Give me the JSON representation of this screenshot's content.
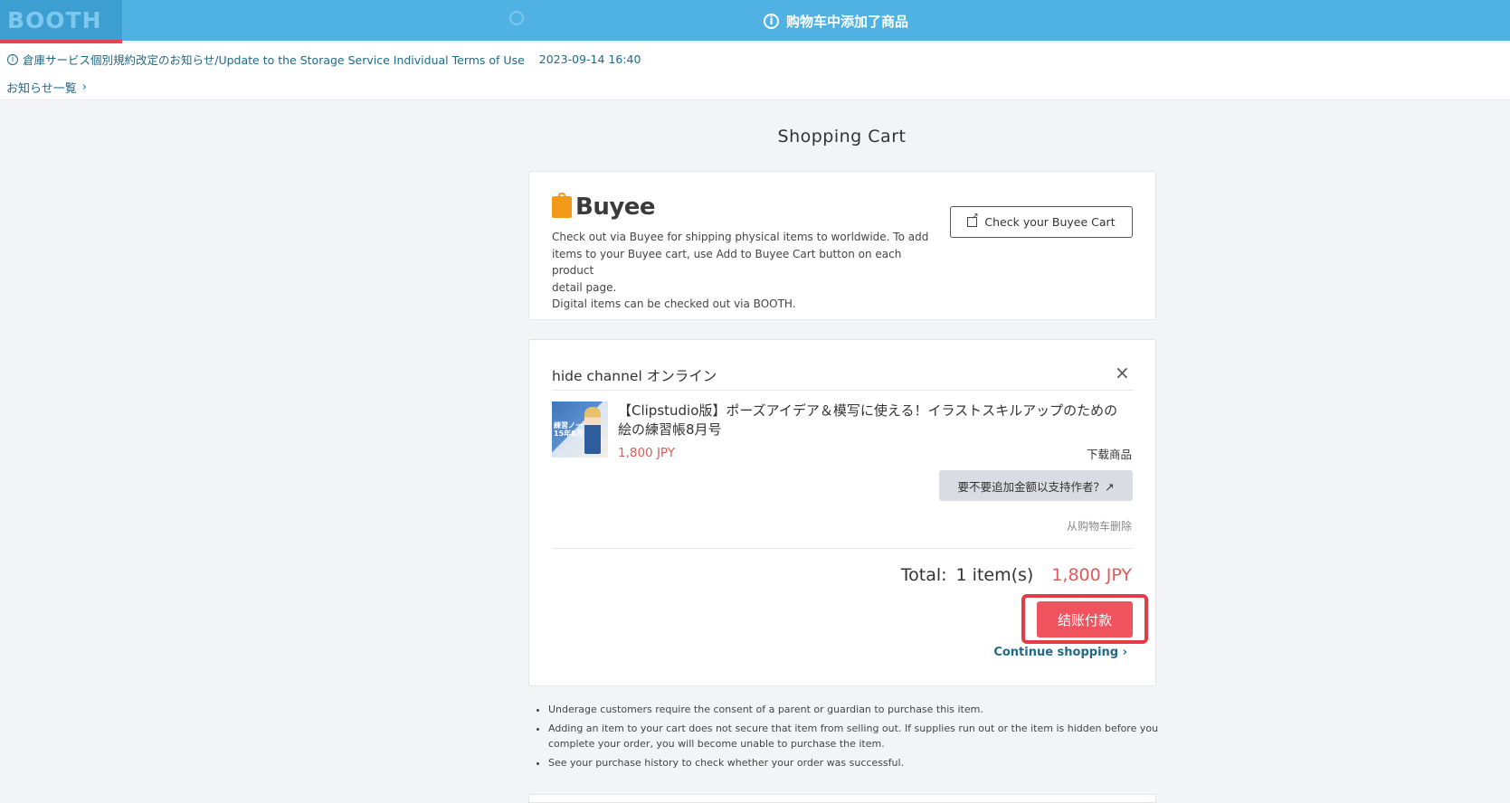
{
  "header": {
    "logo": "BOOTH",
    "toast_message": "购物车中添加了商品",
    "toast_icon": "info-icon",
    "brand_color": "#4fb2e3",
    "accent_color": "#e8414f"
  },
  "notice": {
    "title": "倉庫サービス個別規約改定のお知らせ/Update to the Storage Service Individual Terms of Use",
    "date": "2023-09-14 16:40",
    "list_link": "お知らせ一覧"
  },
  "page_title": "Shopping Cart",
  "buyee": {
    "brand": "Buyee",
    "description_lines": [
      "Check out via Buyee for shipping physical items to worldwide. To add",
      "items to your Buyee cart, use Add to Buyee Cart button on each product",
      "detail page.",
      "Digital items can be checked out via BOOTH."
    ],
    "button_label": "Check your Buyee Cart"
  },
  "cart": {
    "shop_name": "hide channel オンライン",
    "item": {
      "title": "【Clipstudio版】ポーズアイデア＆模写に使える！イラストスキルアップのための絵の練習帳8月号",
      "price": "1,800 JPY",
      "type": "下载商品",
      "thumb_text": "練習ノート\n15年8月号"
    },
    "support_button": "要不要追加金额以支持作者？↗",
    "remove_link": "从购物车删除",
    "total_label": "Total:",
    "total_count": "1 item(s)",
    "total_price": "1,800 JPY",
    "checkout_button": "结账付款",
    "continue_link": "Continue shopping ›",
    "price_color": "#e05a5a"
  },
  "notes": [
    "Underage customers require the consent of a parent or guardian to purchase this item.",
    "Adding an item to your cart does not secure that item from selling out. If supplies run out or the item is hidden before you complete your order, you will become unable to purchase the item.",
    "See your purchase history to check whether your order was successful."
  ]
}
